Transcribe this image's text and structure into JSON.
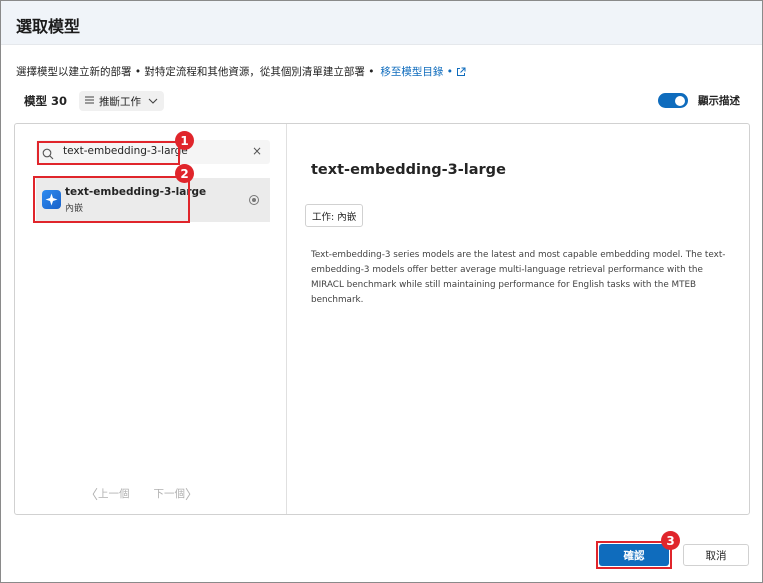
{
  "dialog": {
    "title": "選取模型",
    "description": "選擇模型以建立新的部署 • 對特定流程和其他資源，從其個別清單建立部署 •",
    "catalog_link": "移至模型目錄 •"
  },
  "toolbar": {
    "count_label": "模型 30",
    "filter_label": "推斷工作",
    "toggle_label": "顯示描述",
    "toggle_on": true
  },
  "search": {
    "value": "text-embedding-3-large",
    "clear_glyph": "×"
  },
  "model_list": [
    {
      "name": "text-embedding-3-large",
      "task": "內嵌",
      "selected": true
    }
  ],
  "pager": {
    "prev_arrow": "〈",
    "prev_label": "上一個",
    "next_label": "下一個",
    "next_arrow": "〉"
  },
  "detail": {
    "title": "text-embedding-3-large",
    "task_chip": "工作: 內嵌",
    "description": "Text-embedding-3 series models are the latest and most capable embedding model. The text-embedding-3 models offer better average multi-language retrieval performance with the MIRACL benchmark while still maintaining performance for English tasks with the MTEB benchmark."
  },
  "footer": {
    "confirm_label": "確認",
    "cancel_label": "取消"
  },
  "annotations": [
    "1",
    "2",
    "3"
  ],
  "colors": {
    "accent": "#0f6cbd",
    "highlight": "#e0252b",
    "header_bg": "#f0f4f9"
  }
}
